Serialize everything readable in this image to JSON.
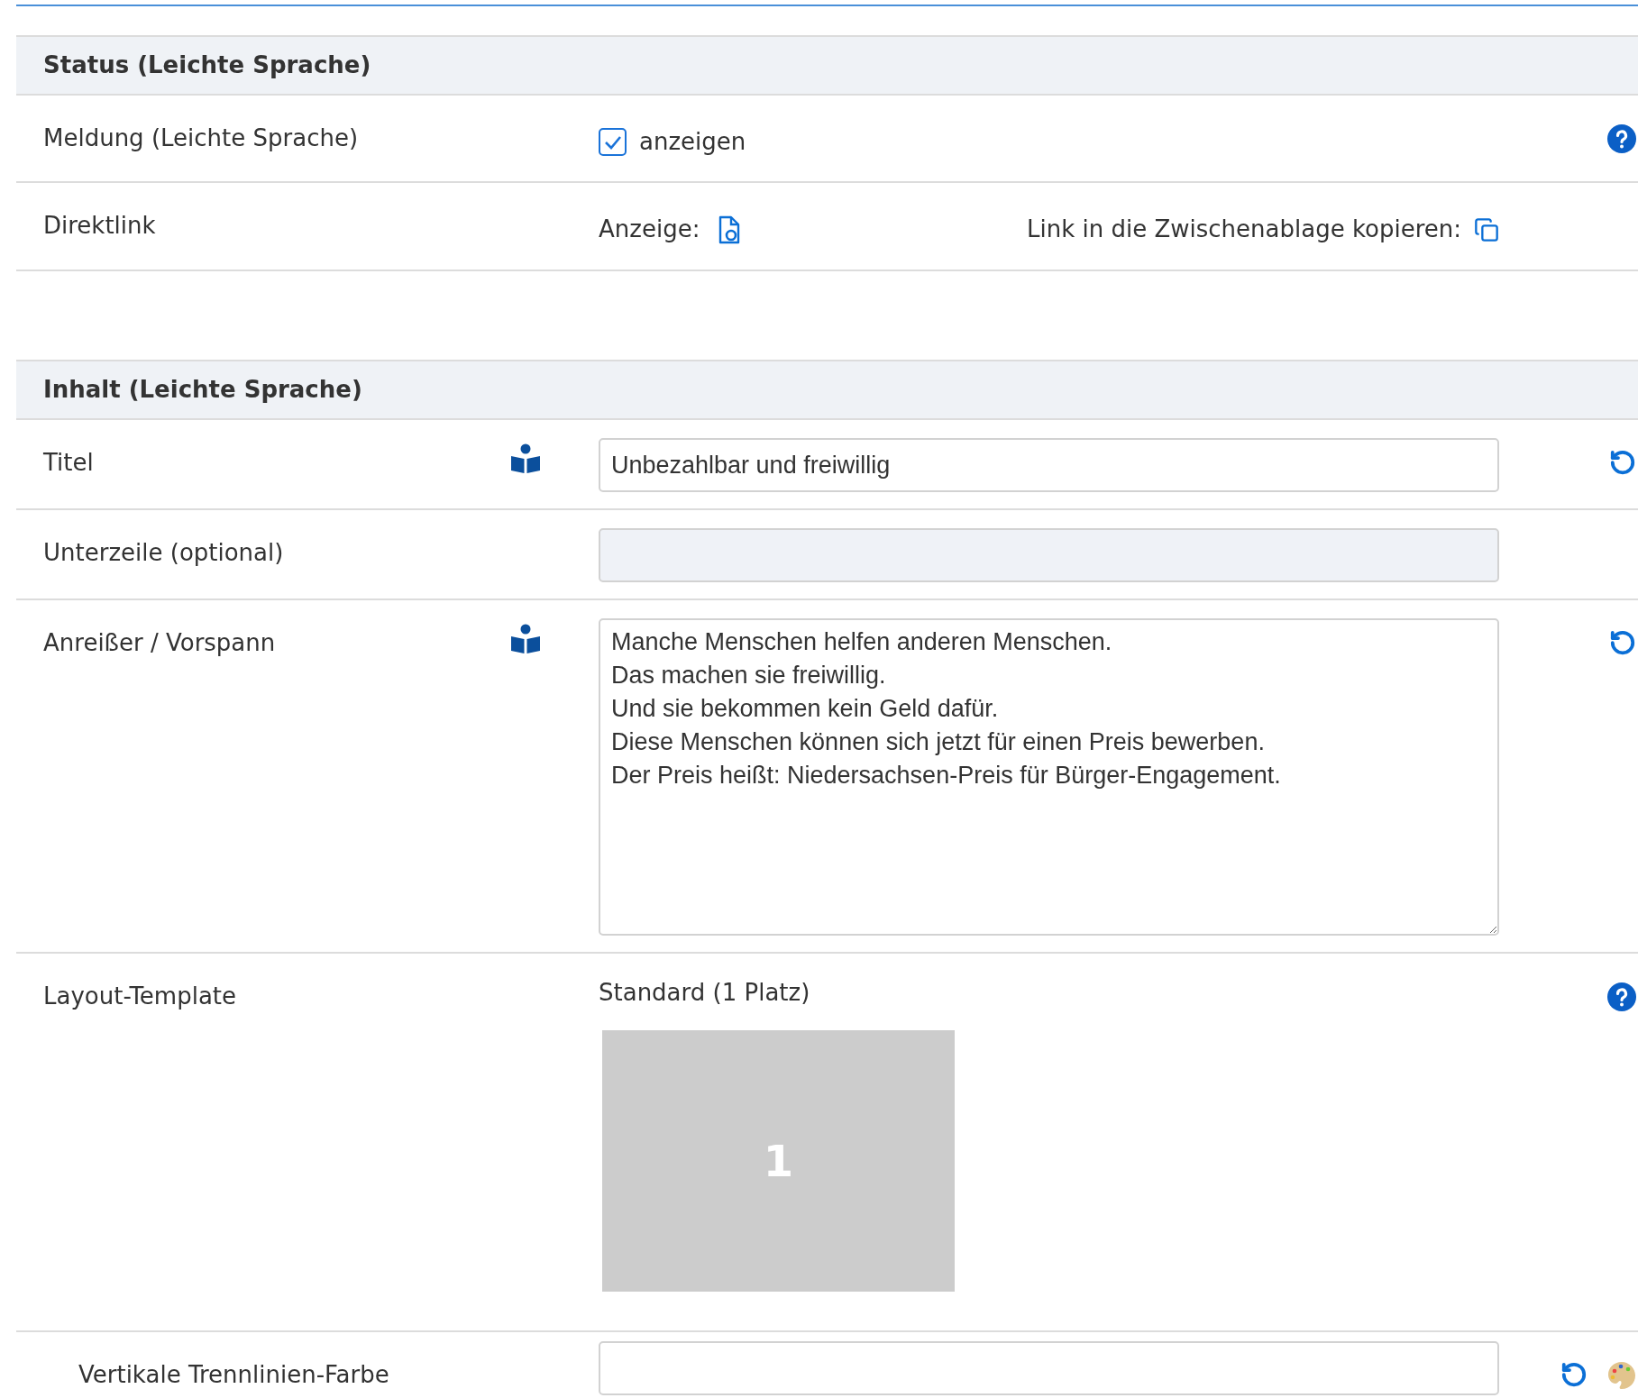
{
  "sections": [
    {
      "title": "Status (Leichte Sprache)",
      "rows": [
        {
          "kind": "checkbox",
          "label": "Meldung (Leichte Sprache)",
          "checked": true,
          "option": "anzeigen",
          "help": true
        },
        {
          "kind": "links",
          "label": "Direktlink",
          "view_label": "Anzeige:",
          "copy_label": "Link in die Zwischenablage kopieren:"
        }
      ]
    },
    {
      "title": "Inhalt (Leichte Sprache)",
      "rows": [
        {
          "kind": "input",
          "label": "Titel",
          "easy_language": true,
          "value": "Unbezahlbar und freiwillig",
          "disabled": false,
          "reset": true
        },
        {
          "kind": "input",
          "label": "Unterzeile (optional)",
          "easy_language": false,
          "disabled": true,
          "reset": false
        },
        {
          "kind": "textarea",
          "label": "Anreißer / Vorspann",
          "easy_language": true,
          "value": "Manche Menschen helfen anderen Menschen.\nDas machen sie freiwillig.\nUnd sie bekommen kein Geld dafür.\nDiese Menschen können sich jetzt für einen Preis bewerben.\nDer Preis heißt: Niedersachsen-Preis für Bürger-Engagement.",
          "reset": true
        },
        {
          "kind": "layout",
          "label": "Layout-Template",
          "value": "Standard (1 Platz)",
          "slots": [
            "1"
          ],
          "help": true,
          "children": [
            {
              "kind": "color",
              "label": "Vertikale Trennlinien-Farbe",
              "reset": true
            }
          ]
        }
      ]
    }
  ]
}
